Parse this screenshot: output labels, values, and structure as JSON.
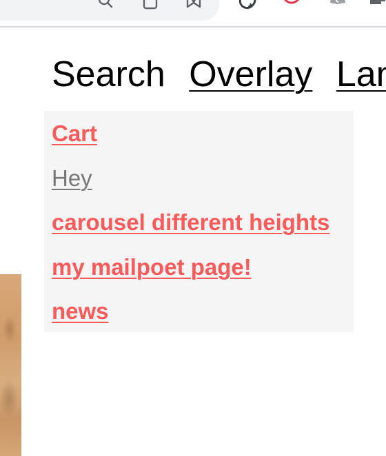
{
  "browser": {
    "icons": [
      "search-icon",
      "install-icon",
      "bookmark-star-icon",
      "sync-extension-icon",
      "record-extension-icon",
      "shopify-extension-icon",
      "puzzle-extension-icon"
    ]
  },
  "nav": {
    "items": [
      {
        "label": "Search"
      },
      {
        "label": "Overlay"
      },
      {
        "label": "Lan"
      }
    ]
  },
  "dropdown": {
    "items": [
      {
        "label": "Cart"
      },
      {
        "label": "Hey"
      },
      {
        "label": "carousel different heights"
      },
      {
        "label": "my mailpoet page!"
      },
      {
        "label": "news"
      }
    ]
  },
  "colors": {
    "link_accent": "#ff5a5a",
    "muted_link": "#777777",
    "panel_background": "#f5f5f5"
  }
}
